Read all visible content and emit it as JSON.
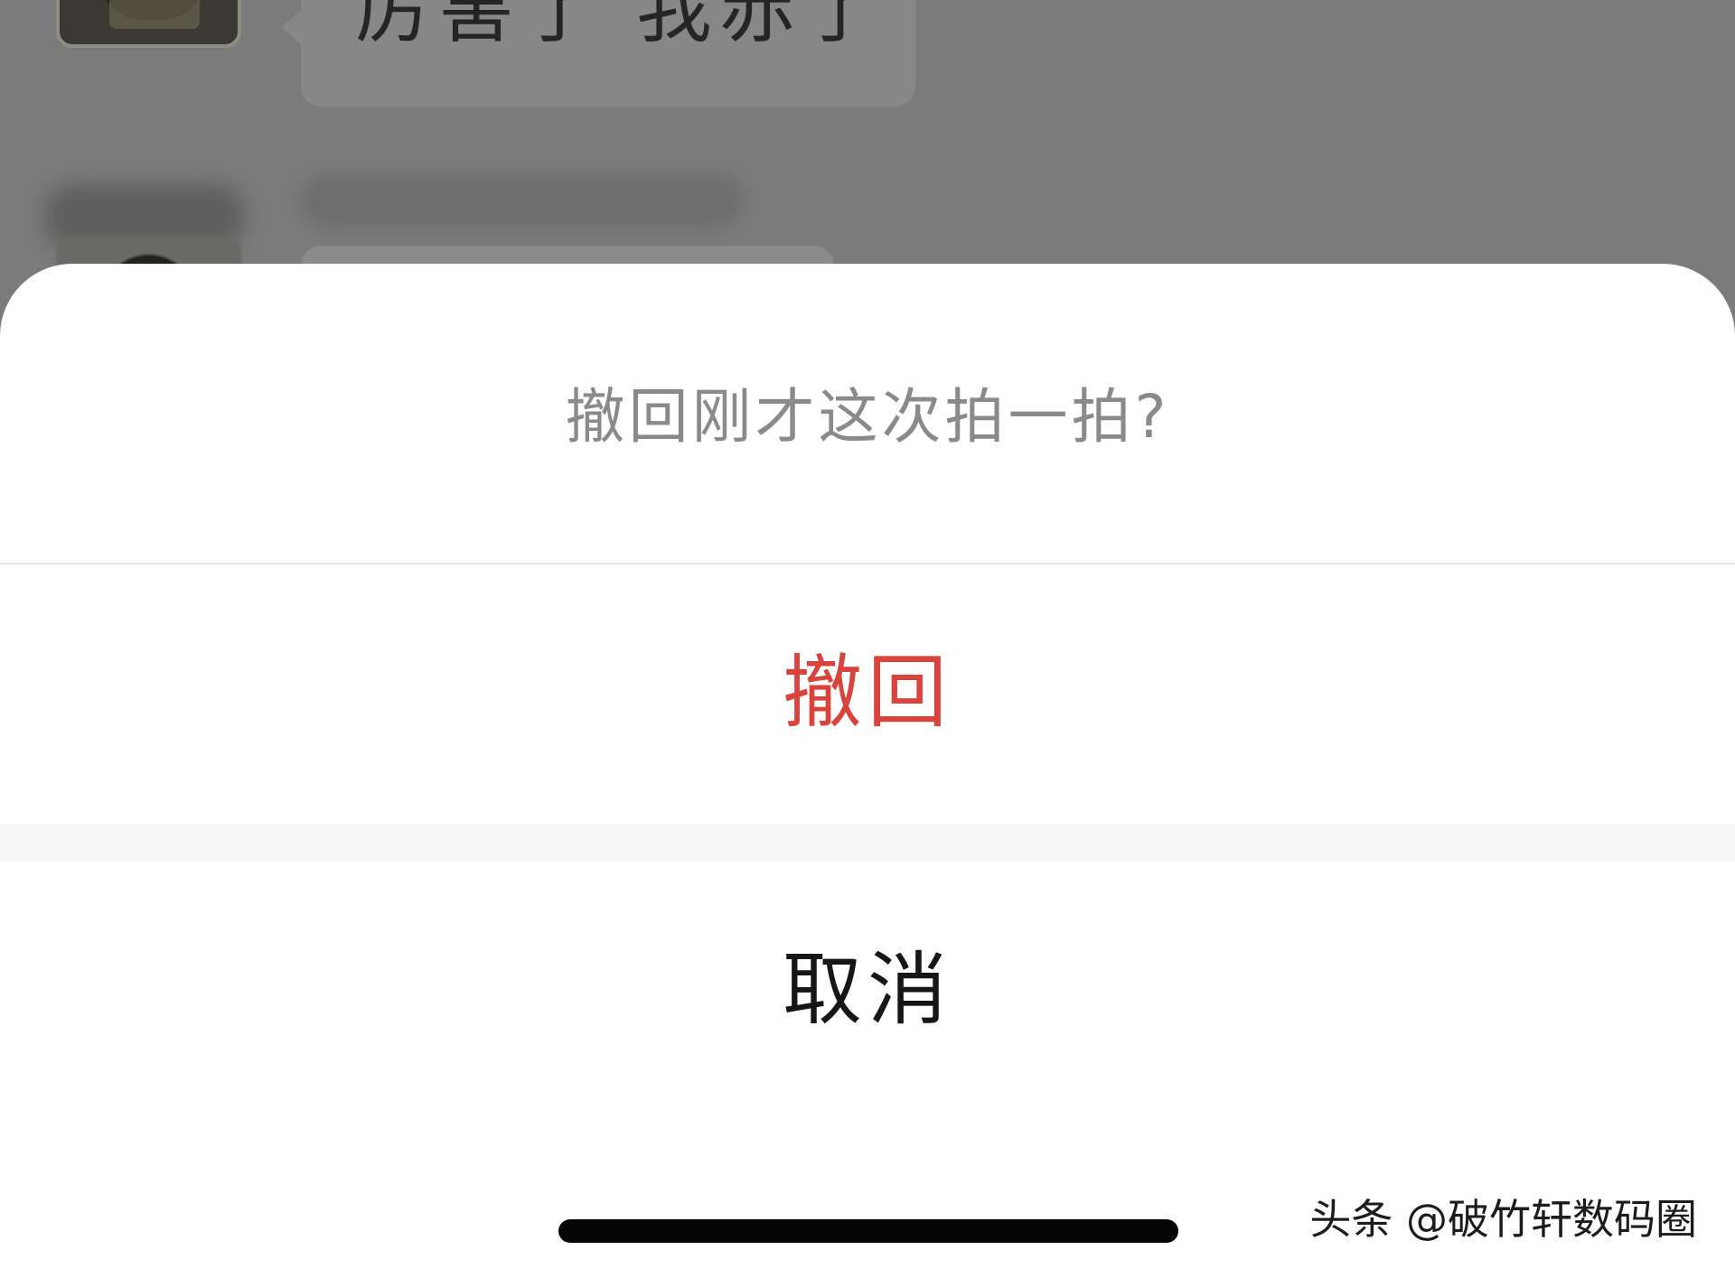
{
  "background_chat": {
    "message_partial_text": "厉害了 我赤了",
    "avatar_description_icon": "user-avatar-icon"
  },
  "action_sheet": {
    "title": "撤回刚才这次拍一拍?",
    "revoke_label": "撤回",
    "cancel_label": "取消"
  },
  "watermark": {
    "text": "头条 @破竹轩数码圈"
  },
  "colors": {
    "overlay_dim": "#7b7b7b",
    "sheet_background": "#ffffff",
    "title_text": "#8a8a8a",
    "destructive_action": "#d9433c",
    "cancel_text": "#161616",
    "separator_band": "#f6f6f6",
    "home_indicator": "#050505"
  }
}
